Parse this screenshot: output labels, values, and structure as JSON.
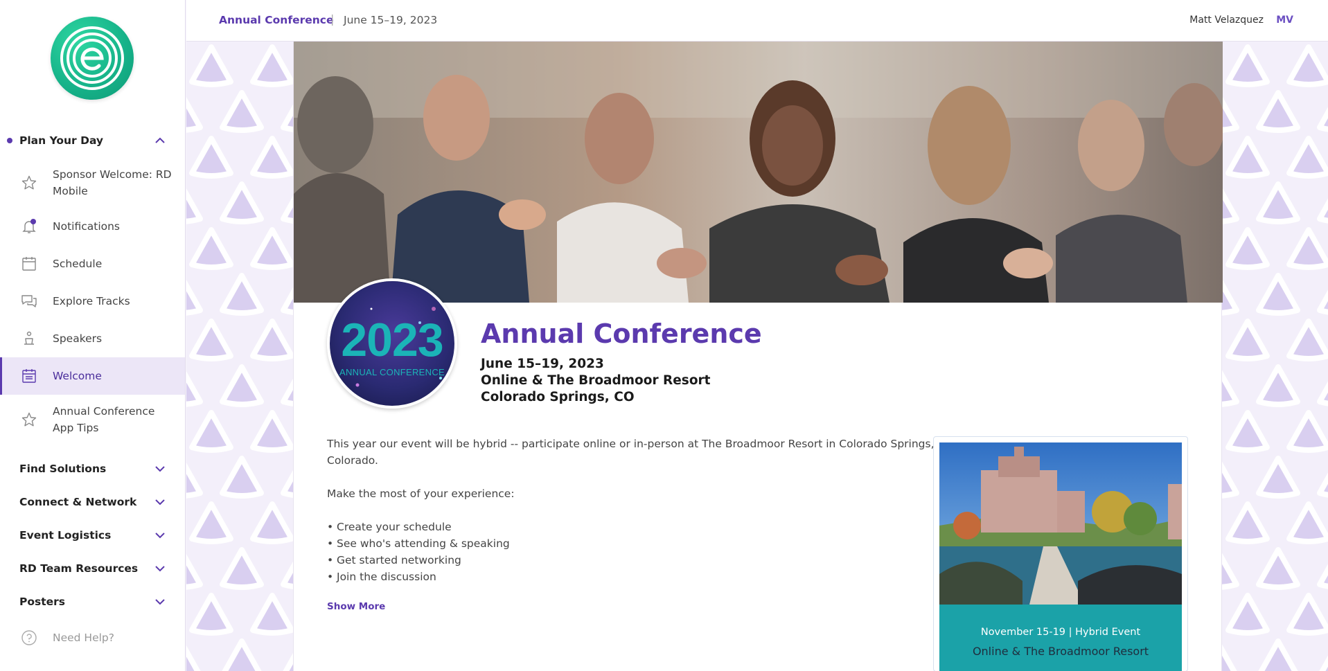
{
  "colors": {
    "brand": "#5b3aae",
    "teal": "#1ba2a8",
    "logo_green": "#17b48a"
  },
  "sidebar": {
    "sections": [
      {
        "label": "Plan Your Day",
        "expanded": true,
        "icon": "chevron-up-icon"
      },
      {
        "label": "Find Solutions",
        "expanded": false,
        "icon": "chevron-down-icon"
      },
      {
        "label": "Connect & Network",
        "expanded": false,
        "icon": "chevron-down-icon"
      },
      {
        "label": "Event Logistics",
        "expanded": false,
        "icon": "chevron-down-icon"
      },
      {
        "label": "RD Team Resources",
        "expanded": false,
        "icon": "chevron-down-icon"
      },
      {
        "label": "Posters",
        "expanded": false,
        "icon": "chevron-down-icon"
      }
    ],
    "items": [
      {
        "label": "Sponsor Welcome: RD Mobile",
        "icon": "star-icon"
      },
      {
        "label": "Notifications",
        "icon": "bell-icon"
      },
      {
        "label": "Schedule",
        "icon": "calendar-icon"
      },
      {
        "label": "Explore Tracks",
        "icon": "chat-bubbles-icon"
      },
      {
        "label": "Speakers",
        "icon": "speaker-podium-icon"
      },
      {
        "label": "Welcome",
        "icon": "welcome-calendar-icon",
        "active": true
      },
      {
        "label": "Annual Conference App Tips",
        "icon": "star-icon"
      }
    ],
    "help": {
      "label": "Need Help?",
      "icon": "question-circle-icon"
    }
  },
  "topbar": {
    "event_name": "Annual Conference",
    "separator": "|",
    "dates": "June 15–19, 2023",
    "user_name": "Matt Velazquez",
    "user_initials": "MV"
  },
  "main": {
    "badge": {
      "year": "2023",
      "subtitle": "ANNUAL CONFERENCE"
    },
    "title": "Annual Conference",
    "date_line": "June 15–19, 2023",
    "venue_line": "Online & The Broadmoor Resort",
    "city_line": "Colorado Springs, CO",
    "intro_line1": "This year our event will be hybrid -- participate online or in-person at The Broadmoor Resort in Colorado Springs,",
    "intro_line2": "Colorado.",
    "make_most": "Make the most of your experience:",
    "bullets": [
      "Create your schedule",
      "See who's attending & speaking",
      "Get started networking",
      "Join the discussion"
    ],
    "bullet_char": "•",
    "show_more": "Show More",
    "promo": {
      "line1": "November 15-19  |  Hybrid Event",
      "line2": "Online & The Broadmoor Resort"
    }
  }
}
